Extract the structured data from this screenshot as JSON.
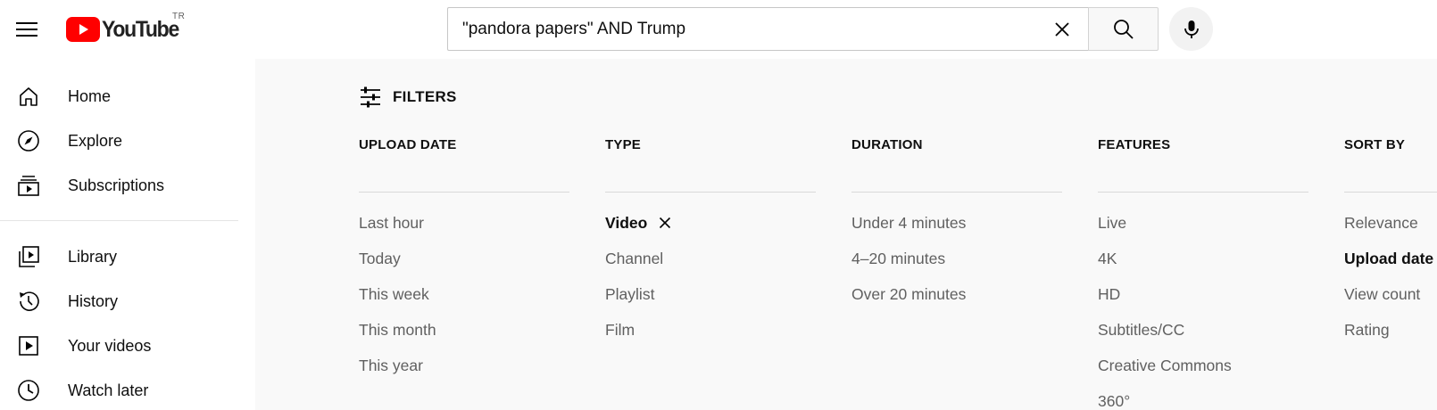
{
  "header": {
    "logo_text": "YouTube",
    "region_code": "TR",
    "search_value": "\"pandora papers\" AND Trump",
    "brand_red": "#FF0000"
  },
  "sidebar": {
    "items": [
      {
        "label": "Home",
        "icon": "home-icon"
      },
      {
        "label": "Explore",
        "icon": "compass-icon"
      },
      {
        "label": "Subscriptions",
        "icon": "subscriptions-icon"
      },
      {
        "label": "Library",
        "icon": "library-icon"
      },
      {
        "label": "History",
        "icon": "history-icon"
      },
      {
        "label": "Your videos",
        "icon": "play-icon"
      },
      {
        "label": "Watch later",
        "icon": "clock-icon"
      }
    ]
  },
  "filters": {
    "toggle_label": "FILTERS",
    "columns": [
      {
        "title": "UPLOAD DATE",
        "options": [
          "Last hour",
          "Today",
          "This week",
          "This month",
          "This year"
        ]
      },
      {
        "title": "TYPE",
        "options": [
          "Video",
          "Channel",
          "Playlist",
          "Film"
        ],
        "active": "Video"
      },
      {
        "title": "DURATION",
        "options": [
          "Under 4 minutes",
          "4–20 minutes",
          "Over 20 minutes"
        ]
      },
      {
        "title": "FEATURES",
        "options": [
          "Live",
          "4K",
          "HD",
          "Subtitles/CC",
          "Creative Commons",
          "360°"
        ]
      },
      {
        "title": "SORT BY",
        "options": [
          "Relevance",
          "Upload date",
          "View count",
          "Rating"
        ],
        "active": "Upload date"
      }
    ]
  }
}
